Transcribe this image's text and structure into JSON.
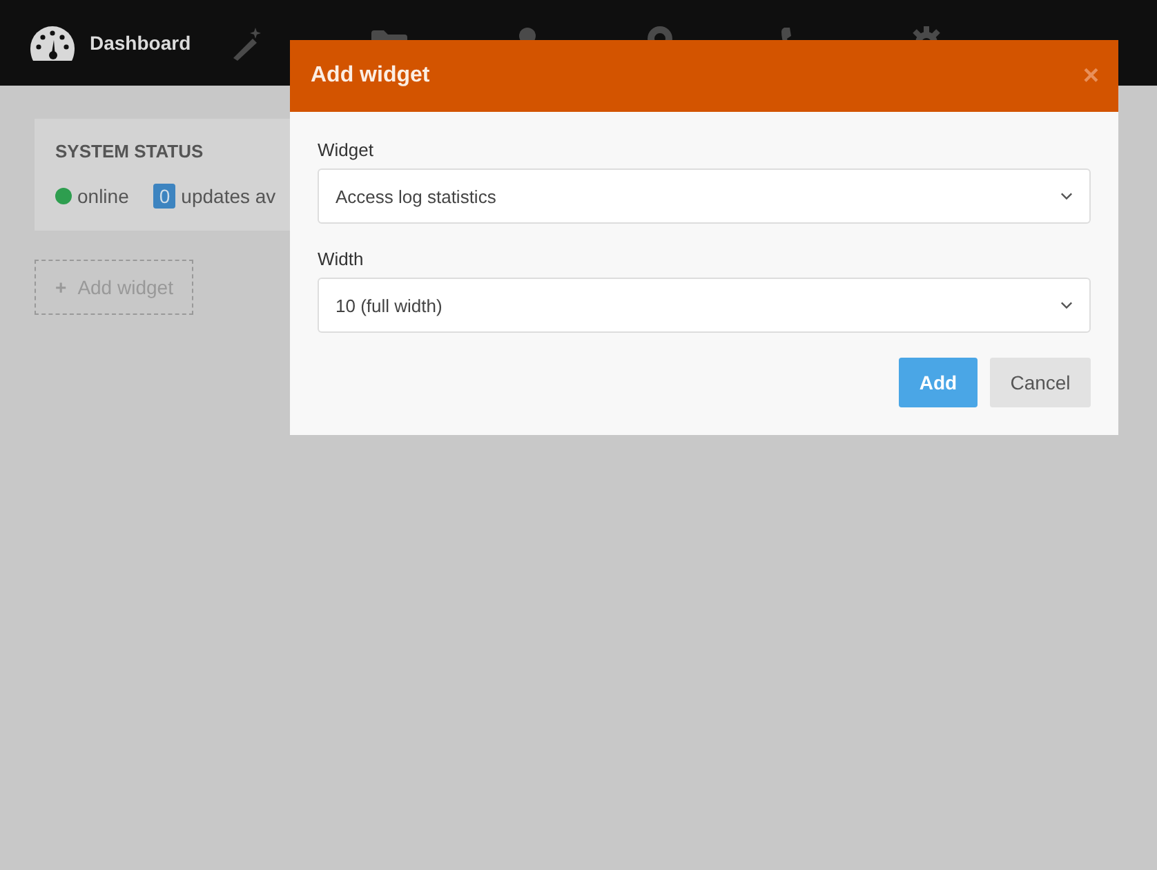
{
  "nav": {
    "brand": "Dashboard"
  },
  "status_card": {
    "title": "SYSTEM STATUS",
    "status": "online",
    "updates_count": "0",
    "updates_text": "updates av"
  },
  "add_widget_button": {
    "icon": "+",
    "label": "Add widget"
  },
  "modal": {
    "title": "Add widget",
    "close": "×",
    "fields": [
      {
        "label": "Widget",
        "value": "Access log statistics"
      },
      {
        "label": "Width",
        "value": "10 (full width)"
      }
    ],
    "buttons": [
      {
        "label": "Add",
        "kind": "primary"
      },
      {
        "label": "Cancel",
        "kind": "secondary"
      }
    ]
  }
}
